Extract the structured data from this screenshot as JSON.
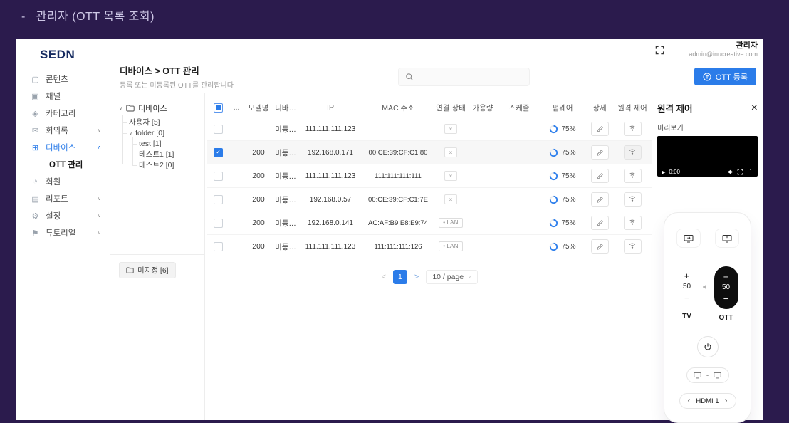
{
  "page_title": "-   관리자 (OTT 목록 조회)",
  "topbar": {
    "user_name": "관리자",
    "user_email": "admin@inucreative.com"
  },
  "icons": {
    "caret_down": "∨",
    "caret_up": "∧",
    "kebab": "⋮",
    "play": "▶",
    "close": "×",
    "page_prev": "<",
    "page_next": ">",
    "chevron_left": "‹",
    "chevron_right": "›",
    "select_caret": "∨"
  },
  "sidebar": {
    "logo": "SEDN",
    "items": [
      {
        "label": "콘텐츠",
        "icon": "contents-icon",
        "glyph": "▢",
        "chevron": "",
        "active": false,
        "sub": false
      },
      {
        "label": "채널",
        "icon": "channel-icon",
        "glyph": "▣",
        "chevron": "",
        "active": false,
        "sub": false
      },
      {
        "label": "카테고리",
        "icon": "category-icon",
        "glyph": "◈",
        "chevron": "",
        "active": false,
        "sub": false
      },
      {
        "label": "회의록",
        "icon": "minutes-icon",
        "glyph": "✉",
        "chevron": "down",
        "active": false,
        "sub": false
      },
      {
        "label": "디바이스",
        "icon": "device-icon",
        "glyph": "⊞",
        "chevron": "up",
        "active": true,
        "sub": false
      },
      {
        "label": "OTT 관리",
        "icon": "",
        "glyph": "",
        "chevron": "",
        "active": false,
        "sub": true
      },
      {
        "label": "회원",
        "icon": "member-icon",
        "glyph": "◔",
        "chevron": "",
        "active": false,
        "sub": false
      },
      {
        "label": "리포트",
        "icon": "report-icon",
        "glyph": "▤",
        "chevron": "down",
        "active": false,
        "sub": false
      },
      {
        "label": "설정",
        "icon": "settings-icon",
        "glyph": "⚙",
        "chevron": "down",
        "active": false,
        "sub": false
      },
      {
        "label": "튜토리얼",
        "icon": "tutorial-icon",
        "glyph": "⚑",
        "chevron": "down",
        "active": false,
        "sub": false
      }
    ]
  },
  "header": {
    "breadcrumb": "디바이스 > OTT 관리",
    "subtitle": "등록 또는 미등록된 OTT를 관리합니다",
    "register_label": "OTT 등록"
  },
  "tree": {
    "root_label": "디바이스",
    "nodes": [
      {
        "label": "사용자 [5]",
        "depth": 1,
        "caret": false
      },
      {
        "label": "folder [0]",
        "depth": 1,
        "caret": true
      },
      {
        "label": "test [1]",
        "depth": 2,
        "caret": false
      },
      {
        "label": "테스트1 [1]",
        "depth": 2,
        "caret": false
      },
      {
        "label": "테스트2 [0]",
        "depth": 2,
        "caret": false
      }
    ],
    "unassigned_label": "미지정 [6]"
  },
  "table": {
    "headers": {
      "dots": "...",
      "model": "모델명",
      "device": "디바…",
      "ip": "IP",
      "mac": "MAC 주소",
      "status": "연결 상태",
      "capacity": "가용량",
      "schedule": "스케줄",
      "firmware": "펌웨어",
      "detail": "상세",
      "remote": "원격 제어"
    },
    "rows": [
      {
        "checked": false,
        "model": "",
        "device": "미등…",
        "ip": "111.111.111.123",
        "mac": "",
        "status": "x",
        "firmware": "75%"
      },
      {
        "checked": true,
        "model": "200",
        "device": "미등…",
        "ip": "192.168.0.171",
        "mac": "00:CE:39:CF:C1:80",
        "status": "x",
        "firmware": "75%"
      },
      {
        "checked": false,
        "model": "200",
        "device": "미등…",
        "ip": "111.111.111.123",
        "mac": "111:111:111:111",
        "status": "x",
        "firmware": "75%"
      },
      {
        "checked": false,
        "model": "200",
        "device": "미등…",
        "ip": "192.168.0.57",
        "mac": "00:CE:39:CF:C1:7E",
        "status": "x",
        "firmware": "75%"
      },
      {
        "checked": false,
        "model": "200",
        "device": "미등…",
        "ip": "192.168.0.141",
        "mac": "AC:AF:B9:E8:E9:74",
        "status": "LAN",
        "firmware": "75%"
      },
      {
        "checked": false,
        "model": "200",
        "device": "미등…",
        "ip": "111.111.111.123",
        "mac": "111:111:111:126",
        "status": "LAN",
        "firmware": "75%"
      }
    ]
  },
  "pagination": {
    "page": "1",
    "size_label": "10 / page"
  },
  "remote_panel": {
    "title": "원격 제어",
    "preview_label": "미리보기",
    "player_time": "0:00",
    "tv_label": "TV",
    "ott_label": "OTT",
    "tv_volume": "50",
    "ott_volume": "50",
    "plus": "+",
    "minus": "−",
    "input_dash": "-",
    "hdmi_label": "HDMI 1"
  }
}
